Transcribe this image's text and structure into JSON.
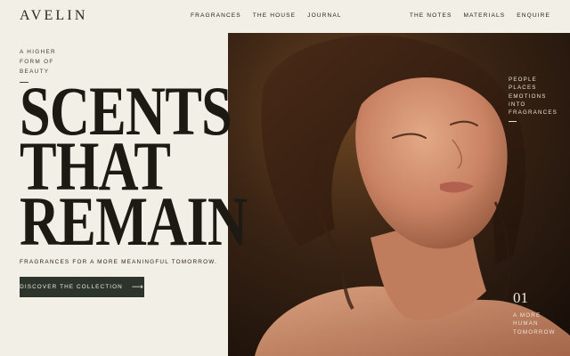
{
  "brand": {
    "logo": "AVELIN"
  },
  "nav_left": [
    "FRAGRANCES",
    "THE HOUSE",
    "JOURNAL"
  ],
  "nav_right": [
    "THE NOTES",
    "MATERIALS",
    "ENQUIRE"
  ],
  "hero": {
    "tagline": [
      "A HIGHER",
      "FORM OF",
      "BEAUTY"
    ],
    "headline": [
      "SCENTS",
      "THAT",
      "REMAIN"
    ],
    "subline": "FRAGRANCES FOR A MORE MEANINGFUL TOMORROW.",
    "cta_label": "DISCOVER THE COLLECTION",
    "cta_arrow": "⟶"
  },
  "image_side": {
    "lines": [
      "PEOPLE",
      "PLACES",
      "EMOTIONS",
      "INTO",
      "FRAGRANCES"
    ]
  },
  "counter": {
    "number": "01",
    "lines": [
      "A MORE",
      "HUMAN",
      "TOMORROW"
    ]
  },
  "colors": {
    "background": "#f1efe6",
    "cta_background": "#2d342b",
    "text": "#1f1b16",
    "image_overlay_text": "#ece4d6"
  }
}
